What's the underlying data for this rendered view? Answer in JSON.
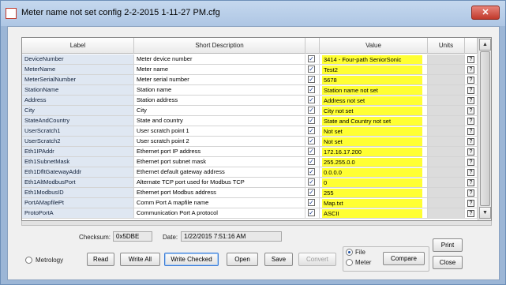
{
  "window": {
    "title": "Meter name not set config 2-2-2015 1-11-27 PM.cfg",
    "close_glyph": "✕"
  },
  "columns": {
    "label": "Label",
    "desc": "Short Description",
    "value": "Value",
    "units": "Units"
  },
  "rows": [
    {
      "label": "DeviceNumber",
      "desc": "Meter device number",
      "value": "3414 - Four-path SeniorSonic"
    },
    {
      "label": "MeterName",
      "desc": "Meter name",
      "value": "Test2"
    },
    {
      "label": "MeterSerialNumber",
      "desc": "Meter serial number",
      "value": "5678"
    },
    {
      "label": "StationName",
      "desc": "Station name",
      "value": "Station name not set"
    },
    {
      "label": "Address",
      "desc": "Station address",
      "value": "Address not set"
    },
    {
      "label": "City",
      "desc": "City",
      "value": "City not set"
    },
    {
      "label": "StateAndCountry",
      "desc": "State and country",
      "value": "State and Country not set"
    },
    {
      "label": "UserScratch1",
      "desc": "User scratch point 1",
      "value": "Not set"
    },
    {
      "label": "UserScratch2",
      "desc": "User scratch point 2",
      "value": "Not set"
    },
    {
      "label": "Eth1IPAddr",
      "desc": "Ethernet port IP address",
      "value": "172.16.17.200"
    },
    {
      "label": "Eth1SubnetMask",
      "desc": "Ethernet port subnet mask",
      "value": "255.255.0.0"
    },
    {
      "label": "Eth1DfltGatewayAddr",
      "desc": "Ethernet default gateway address",
      "value": "0.0.0.0"
    },
    {
      "label": "Eth1AltModbusPort",
      "desc": "Alternate TCP port used for Modbus TCP",
      "value": "0"
    },
    {
      "label": "Eth1ModbusID",
      "desc": "Ethernet port Modbus address",
      "value": "255"
    },
    {
      "label": "PortAMapfilePt",
      "desc": "Comm Port A mapfile name",
      "value": "Map.txt"
    },
    {
      "label": "ProtoPortA",
      "desc": "Communication Port A protocol",
      "value": "ASCII"
    }
  ],
  "check_glyph": "✓",
  "help_glyph": "?",
  "scroll": {
    "up": "▲",
    "down": "▼"
  },
  "checksum": {
    "label": "Checksum:",
    "value": "0x5DBE"
  },
  "date": {
    "label": "Date:",
    "value": "1/22/2015 7:51:16 AM"
  },
  "metrology_label": "Metrology",
  "buttons": {
    "read": "Read",
    "write_all": "Write All",
    "write_checked": "Write Checked",
    "open": "Open",
    "save": "Save",
    "convert": "Convert",
    "compare": "Compare",
    "print": "Print",
    "close": "Close"
  },
  "source": {
    "file": "File",
    "meter": "Meter",
    "selected": "File"
  },
  "colors": {
    "value_highlight": "#ffff33",
    "label_bg": "#dfe7f2",
    "window_frame": "#9cb6d6"
  }
}
